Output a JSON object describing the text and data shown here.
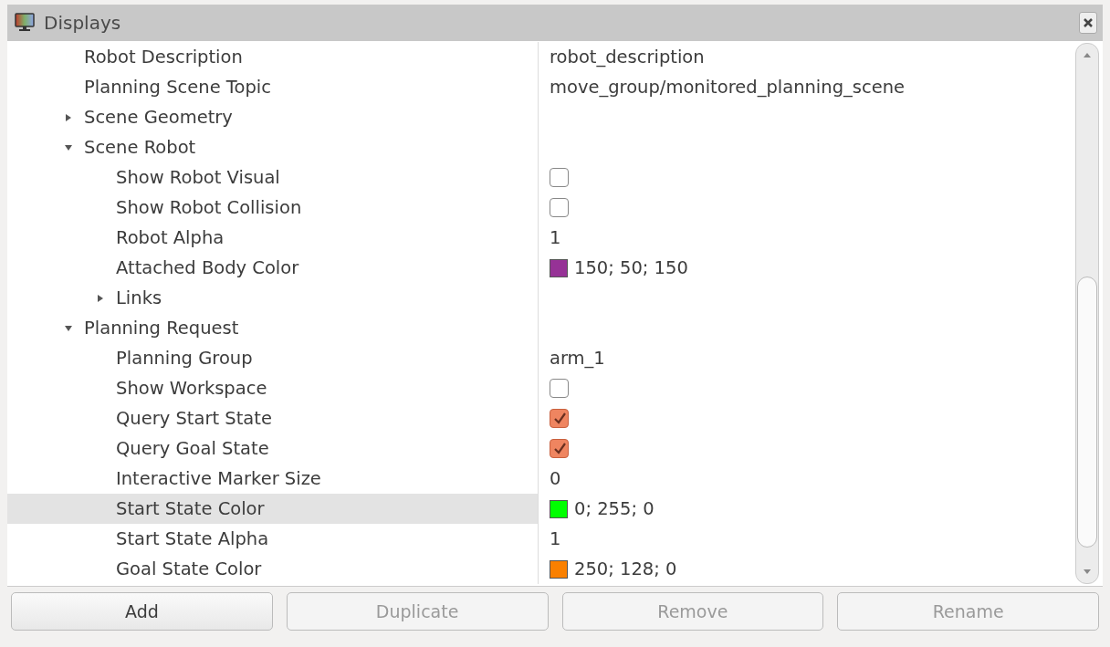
{
  "panel": {
    "title": "Displays"
  },
  "tree": [
    {
      "label": "Robot Description",
      "kind": "text",
      "value": "robot_description",
      "selected": false
    },
    {
      "label": "Planning Scene Topic",
      "kind": "text",
      "value": "move_group/monitored_planning_scene",
      "selected": false
    },
    {
      "label": "Scene Geometry",
      "kind": "group",
      "expanded": false,
      "selected": false
    },
    {
      "label": "Scene Robot",
      "kind": "group",
      "expanded": true,
      "selected": false,
      "children": [
        {
          "label": "Show Robot Visual",
          "kind": "check",
          "checked": false,
          "selected": false
        },
        {
          "label": "Show Robot Collision",
          "kind": "check",
          "checked": false,
          "selected": false
        },
        {
          "label": "Robot Alpha",
          "kind": "text",
          "value": "1",
          "selected": false
        },
        {
          "label": "Attached Body Color",
          "kind": "color",
          "value": "150; 50; 150",
          "color": "#963296",
          "selected": false
        },
        {
          "label": "Links",
          "kind": "group",
          "expanded": false,
          "selected": false
        }
      ]
    },
    {
      "label": "Planning Request",
      "kind": "group",
      "expanded": true,
      "selected": false,
      "children": [
        {
          "label": "Planning Group",
          "kind": "text",
          "value": "arm_1",
          "selected": false
        },
        {
          "label": "Show Workspace",
          "kind": "check",
          "checked": false,
          "selected": false
        },
        {
          "label": "Query Start State",
          "kind": "check",
          "checked": true,
          "selected": false
        },
        {
          "label": "Query Goal State",
          "kind": "check",
          "checked": true,
          "selected": false
        },
        {
          "label": "Interactive Marker Size",
          "kind": "text",
          "value": "0",
          "selected": false
        },
        {
          "label": "Start State Color",
          "kind": "color",
          "value": "0; 255; 0",
          "color": "#00ff00",
          "selected": true
        },
        {
          "label": "Start State Alpha",
          "kind": "text",
          "value": "1",
          "selected": false
        },
        {
          "label": "Goal State Color",
          "kind": "color",
          "value": "250; 128; 0",
          "color": "#fa8000",
          "selected": false
        }
      ]
    }
  ],
  "buttons": [
    {
      "label": "Add",
      "disabled": false
    },
    {
      "label": "Duplicate",
      "disabled": true
    },
    {
      "label": "Remove",
      "disabled": true
    },
    {
      "label": "Rename",
      "disabled": true
    }
  ]
}
